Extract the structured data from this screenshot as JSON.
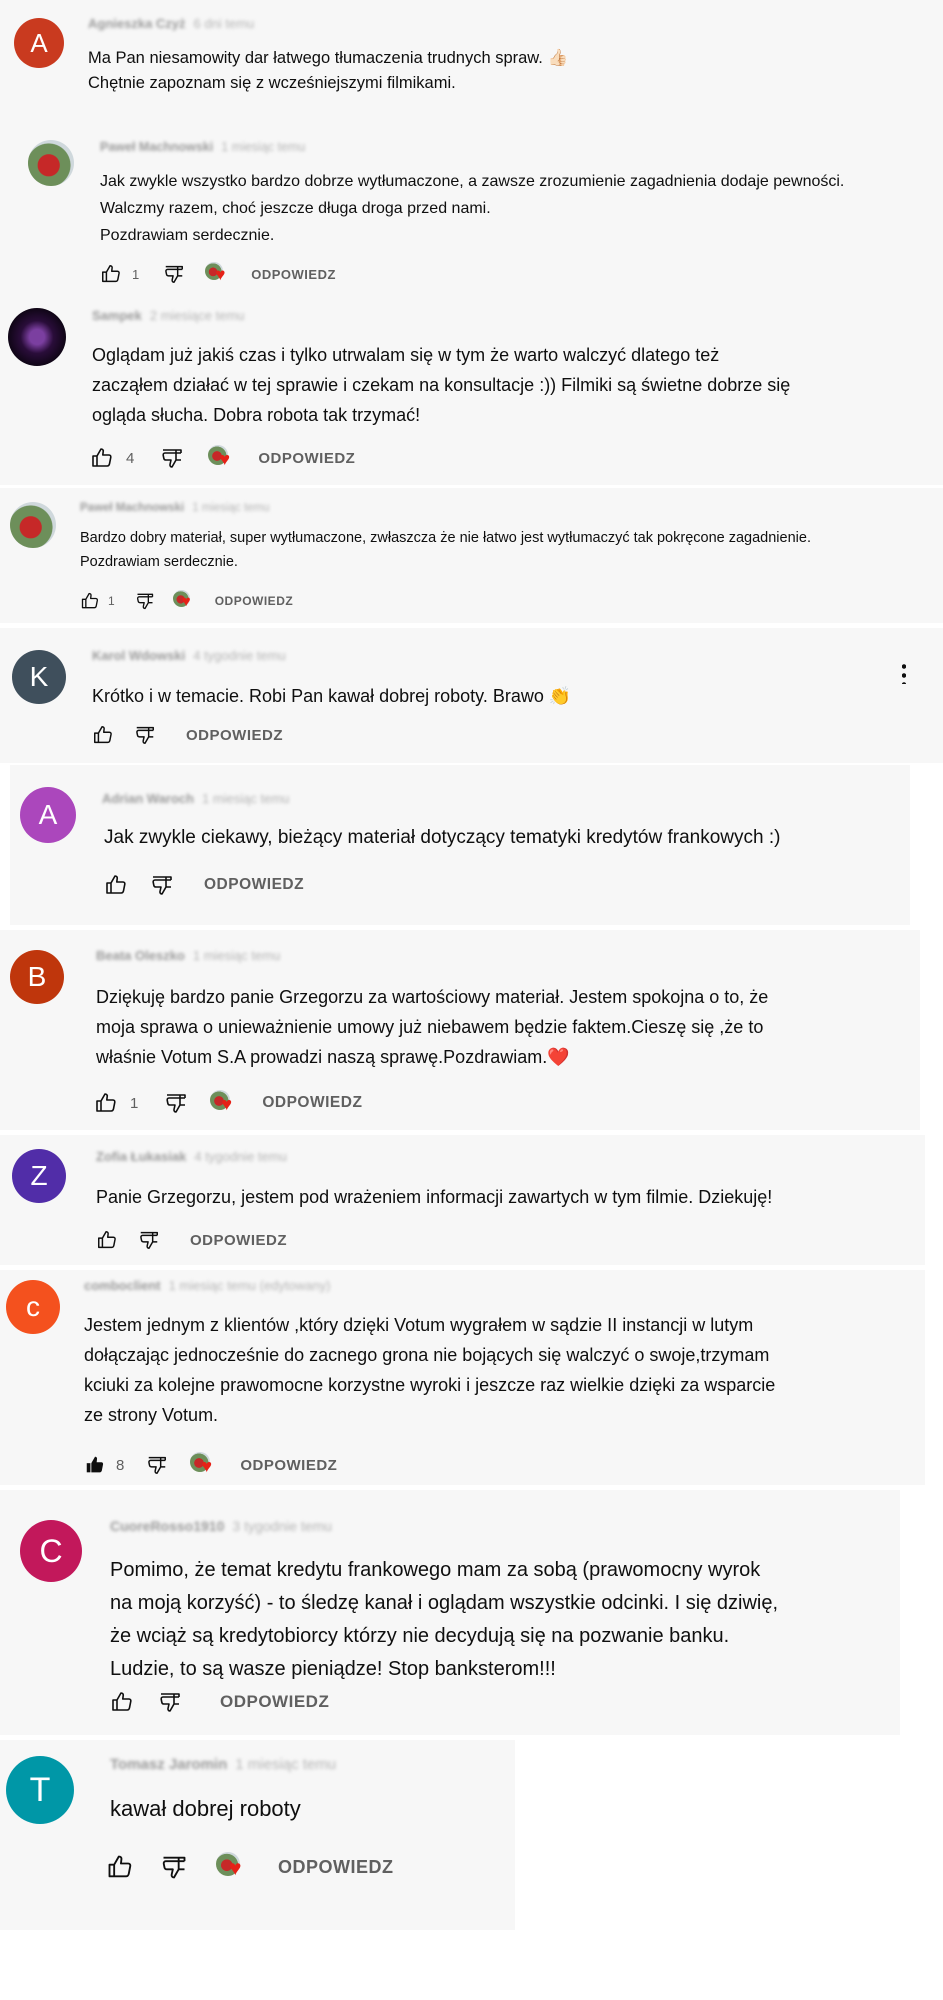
{
  "reply_label": "ODPOWIEDZ",
  "colors": {
    "avatar_A": "#c93a1f",
    "avatar_K": "#3f4f5c",
    "avatar_A2": "#ab47bc",
    "avatar_B": "#bf360c",
    "avatar_Z": "#512da8",
    "avatar_c": "#f4511e",
    "avatar_C": "#c2185b",
    "avatar_T": "#0097a7",
    "heart": "#e62117"
  },
  "comments": [
    {
      "initial": "A",
      "author": "Agnieszka Czyż",
      "meta": "6 dni temu",
      "text": "Ma Pan niesamowity dar łatwego tłumaczenia trudnych spraw. 👍🏻\nChętnie zapoznam się z wcześniejszymi filmikami."
    },
    {
      "initial": "",
      "author": "Paweł Machnowski",
      "meta": "1 miesiąc temu",
      "text": "Jak zwykle wszystko bardzo dobrze wytłumaczone, a zawsze zrozumienie zagadnienia dodaje pewności.\nWalczmy razem, choć jeszcze długa droga przed nami.\nPozdrawiam serdecznie.",
      "likes": "1"
    },
    {
      "initial": "",
      "author": "Sampek",
      "meta": "2 miesiące temu",
      "text": "Oglądam już jakiś czas i tylko utrwalam się w tym że warto walczyć dlatego też\nzacząłem działać w tej sprawie i czekam na konsultacje :)) Filmiki są świetne dobrze się\nogląda słucha. Dobra robota tak trzymać!",
      "likes": "4"
    },
    {
      "initial": "",
      "author": "Paweł Machnowski",
      "meta": "1 miesiąc temu",
      "text": "Bardzo dobry materiał, super wytłumaczone, zwłaszcza że nie łatwo jest wytłumaczyć tak pokręcone zagadnienie.\nPozdrawiam serdecznie.",
      "likes": "1"
    },
    {
      "initial": "K",
      "author": "Karol Wdowski",
      "meta": "4 tygodnie temu",
      "text": "Krótko i w temacie. Robi Pan kawał dobrej roboty. Brawo 👏"
    },
    {
      "initial": "A",
      "author": "Adrian Waroch",
      "meta": "1 miesiąc temu",
      "text": "Jak zwykle ciekawy, bieżący materiał dotyczący tematyki kredytów frankowych :)"
    },
    {
      "initial": "B",
      "author": "Beata Oleszko",
      "meta": "1 miesiąc temu",
      "text": "Dziękuję bardzo panie Grzegorzu za wartościowy materiał.  Jestem spokojna o to, że\nmoja sprawa o unieważnienie umowy   już niebawem będzie faktem.Cieszę się ,że to\nwłaśnie Votum S.A prowadzi naszą sprawę.Pozdrawiam.❤️",
      "likes": "1"
    },
    {
      "initial": "Z",
      "author": "Zofia Łukasiak",
      "meta": "4 tygodnie temu",
      "text": "Panie Grzegorzu, jestem pod wrażeniem informacji zawartych w tym filmie. Dziekuję!"
    },
    {
      "initial": "c",
      "author": "comboclient",
      "meta": "1 miesiąc temu (edytowany)",
      "text": "Jestem jednym z klientów ,który dzięki Votum wygrałem w sądzie II instancji w lutym\ndołączając jednocześnie do zacnego grona nie bojących się walczyć o swoje,trzymam\nkciuki za kolejne prawomocne korzystne wyroki i jeszcze raz wielkie dzięki za wsparcie\nze strony Votum.",
      "likes": "8"
    },
    {
      "initial": "C",
      "author": "CuoreRosso1910",
      "meta": "3 tygodnie temu",
      "text": "Pomimo, że temat kredytu frankowego mam za sobą (prawomocny wyrok\nna moją korzyść) - to śledzę kanał i oglądam wszystkie odcinki. I się dziwię,\nże wciąż są kredytobiorcy którzy nie decydują się na pozwanie banku.\nLudzie, to są wasze pieniądze! Stop banksterom!!!"
    },
    {
      "initial": "T",
      "author": "Tomasz Jaromin",
      "meta": "1 miesiąc temu",
      "text": "kawał dobrej roboty"
    }
  ]
}
